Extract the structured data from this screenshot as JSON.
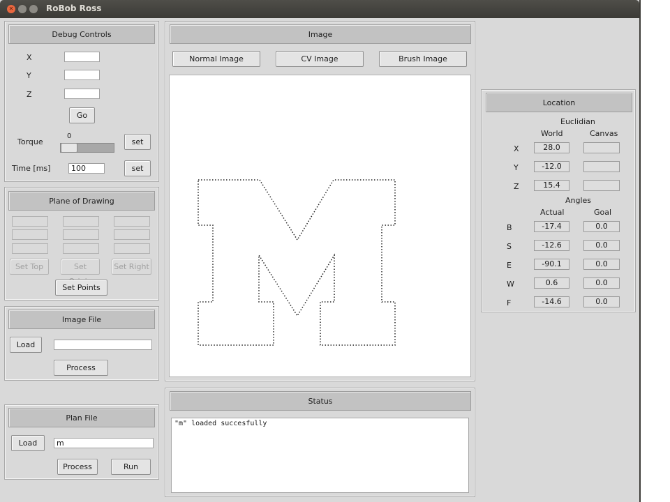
{
  "window": {
    "title": "RoBob Ross"
  },
  "debug": {
    "header": "Debug Controls",
    "x_label": "X",
    "y_label": "Y",
    "z_label": "Z",
    "go": "Go",
    "torque_label": "Torque",
    "torque_value": "0",
    "set_torque": "set",
    "time_label": "Time [ms]",
    "time_value": "100",
    "set_time": "set"
  },
  "plane": {
    "header": "Plane of Drawing",
    "set_top": "Set Top",
    "set_origin": "Set Origin",
    "set_right": "Set Right",
    "set_points": "Set Points"
  },
  "image_file": {
    "header": "Image File",
    "load": "Load",
    "path": "",
    "process": "Process"
  },
  "plan_file": {
    "header": "Plan File",
    "load": "Load",
    "path": "m",
    "process": "Process",
    "run": "Run"
  },
  "image": {
    "header": "Image",
    "normal": "Normal Image",
    "cv": "CV Image",
    "brush": "Brush Image"
  },
  "status": {
    "header": "Status",
    "message": "\"m\" loaded succesfully"
  },
  "location": {
    "header": "Location",
    "euclidian": "Euclidian",
    "world": "World",
    "canvas": "Canvas",
    "rows": [
      {
        "label": "X",
        "world": "28.0",
        "canvas": ""
      },
      {
        "label": "Y",
        "world": "-12.0",
        "canvas": ""
      },
      {
        "label": "Z",
        "world": "15.4",
        "canvas": ""
      }
    ],
    "angles": "Angles",
    "actual": "Actual",
    "goal": "Goal",
    "angle_rows": [
      {
        "label": "B",
        "actual": "-17.4",
        "goal": "0.0"
      },
      {
        "label": "S",
        "actual": "-12.6",
        "goal": "0.0"
      },
      {
        "label": "E",
        "actual": "-90.1",
        "goal": "0.0"
      },
      {
        "label": "W",
        "actual": "0.6",
        "goal": "0.0"
      },
      {
        "label": "F",
        "actual": "-14.6",
        "goal": "0.0"
      }
    ]
  }
}
